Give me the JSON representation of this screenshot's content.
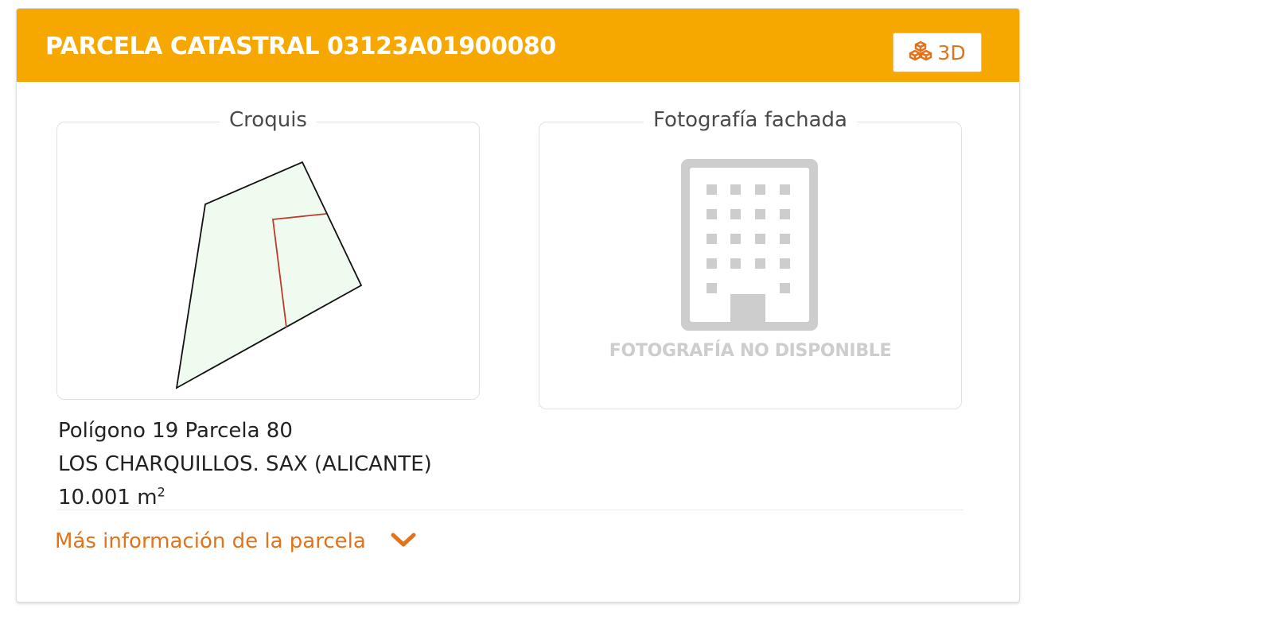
{
  "header": {
    "title": "PARCELA CATASTRAL 03123A01900080",
    "button_3d_label": "3D",
    "button_3d_icon": "cubes-icon",
    "background_color": "#f7a800"
  },
  "sketch": {
    "legend": "Croquis",
    "fill_color": "#eefbee",
    "outline_color": "#111111",
    "internal_boundary_color": "#c0392b"
  },
  "photo": {
    "legend": "Fotografía fachada",
    "placeholder_icon": "building-icon",
    "placeholder_text": "FOTOGRAFÍA NO DISPONIBLE"
  },
  "parcel": {
    "location_line": "Polígono 19 Parcela 80",
    "address_line": "LOS CHARQUILLOS. SAX (ALICANTE)",
    "area_value": "10.001 m",
    "area_exponent": "2"
  },
  "more_info": {
    "label": "Más información de la parcela",
    "icon": "chevron-down-icon",
    "accent_color": "#e2731b"
  }
}
